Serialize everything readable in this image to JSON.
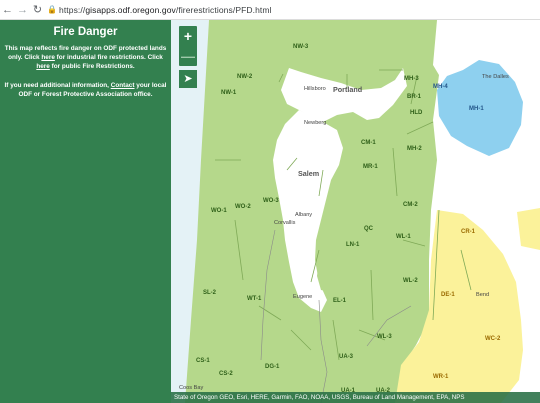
{
  "browser": {
    "back_icon": "arrow-left-icon",
    "forward_icon": "arrow-right-icon",
    "reload_icon": "reload-icon",
    "lock_icon": "lock-icon",
    "url_scheme": "https://",
    "url_host": "gisapps.odf.oregon.gov",
    "url_path": "/firerestrictions/PFD.html"
  },
  "sidebar": {
    "title": "Fire Danger",
    "p1_a": "This map reflects fire danger on ODF protected lands only. Click ",
    "link_here_1": "here",
    "p1_b": " for industrial fire restrictions. Click ",
    "link_here_2": "here",
    "p1_c": " for public Fire Restrictions.",
    "p2_a": "If you need additional information, ",
    "link_contact": "Contact",
    "p2_b": " your local ODF or Forest Protective Association office."
  },
  "map_controls": {
    "zoom_in": "+",
    "zoom_out": "—",
    "locate_icon": "locate-icon"
  },
  "colors": {
    "green_zone": "#b5d88b",
    "yellow_zone": "#fbf29a",
    "blue_zone": "#8ed0ef",
    "panel": "#33804f"
  },
  "zones": {
    "nw3": "NW-3",
    "nw2": "NW-2",
    "nw1": "NW-1",
    "mh3": "MH-3",
    "mh4": "MH-4",
    "mh1": "MH-1",
    "br1": "BR-1",
    "hld": "HLD",
    "mh2": "MH-2",
    "cm1": "CM-1",
    "mr1": "MR-1",
    "cm2": "CM-2",
    "wo1": "WO-1",
    "wo2": "WO-2",
    "wo3": "WO-3",
    "qc": "QC",
    "wl1": "WL-1",
    "ln1": "LN-1",
    "cr1": "CR-1",
    "wl2": "WL-2",
    "de1": "DE-1",
    "sl2": "SL-2",
    "wt1": "WT-1",
    "el1": "EL-1",
    "wc2": "WC-2",
    "wl3": "WL-3",
    "cs1": "CS-1",
    "cs2": "CS-2",
    "dg1": "DG-1",
    "ua3": "UA-3",
    "wr1": "WR-1",
    "ua1": "UA-1",
    "ua2": "UA-2"
  },
  "cities": {
    "hillsboro": "Hillsboro",
    "portland": "Portland",
    "the_dalles": "The Dalles",
    "newberg": "Newberg",
    "salem": "Salem",
    "albany": "Albany",
    "corvallis": "Corvallis",
    "eugene": "Eugene",
    "bend": "Bend",
    "coos_bay": "Coos Bay"
  },
  "attribution": "State of Oregon GEO, Esri, HERE, Garmin, FAO, NOAA, USGS, Bureau of Land Management, EPA, NPS"
}
